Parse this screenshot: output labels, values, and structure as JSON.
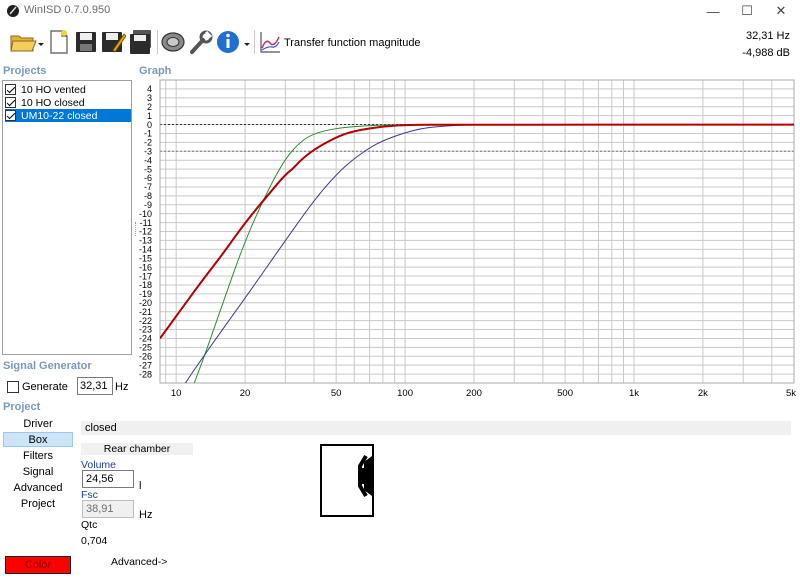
{
  "window": {
    "title": "WinISD 0.7.0.950",
    "minimize_glyph": "—",
    "maximize_glyph": "☐",
    "close_glyph": "✕"
  },
  "toolbar": {
    "icons": [
      "folder-open-icon",
      "new-document-icon",
      "save-icon",
      "save-as-icon",
      "save-all-icon",
      "driver-icon",
      "wrench-icon",
      "info-icon",
      "graph-icon"
    ],
    "graph_type_label": "Transfer function magnitude",
    "readout_freq": "32,31 Hz",
    "readout_level": "-4,988 dB"
  },
  "projects": {
    "label": "Projects",
    "items": [
      {
        "label": "10 HO vented",
        "checked": true,
        "selected": false
      },
      {
        "label": "10 HO closed",
        "checked": true,
        "selected": false
      },
      {
        "label": "UM10-22 closed",
        "checked": true,
        "selected": true
      }
    ]
  },
  "graph": {
    "label": "Graph"
  },
  "chart_data": {
    "type": "line",
    "title": "",
    "xlabel": "",
    "ylabel": "",
    "x_scale": "log",
    "xlim": [
      8.5,
      5000
    ],
    "ylim": [
      -29,
      5
    ],
    "x_tick_labels": [
      "10",
      "20",
      "50",
      "100",
      "200",
      "500",
      "1k",
      "2k",
      "5k"
    ],
    "x_tick_values": [
      10,
      20,
      50,
      100,
      200,
      500,
      1000,
      2000,
      5000
    ],
    "y_tick_values": [
      4,
      3,
      2,
      1,
      0,
      -1,
      -2,
      -3,
      -4,
      -5,
      -6,
      -7,
      -8,
      -9,
      -10,
      -11,
      -12,
      -13,
      -14,
      -15,
      -16,
      -17,
      -18,
      -19,
      -20,
      -21,
      -22,
      -23,
      -24,
      -25,
      -26,
      -27,
      -28
    ],
    "reference_lines": [
      0,
      -3
    ],
    "grid": true,
    "series": [
      {
        "color": "#2e8b2e",
        "width": 1,
        "points": [
          [
            12,
            -29
          ],
          [
            13.5,
            -25.5
          ],
          [
            16,
            -20
          ],
          [
            20,
            -13
          ],
          [
            25,
            -7.5
          ],
          [
            30,
            -3.8
          ],
          [
            35,
            -1.9
          ],
          [
            40,
            -1
          ],
          [
            50,
            -0.4
          ],
          [
            70,
            -0.1
          ],
          [
            100,
            0
          ],
          [
            200,
            0
          ]
        ]
      },
      {
        "color": "#3a3a8a",
        "width": 1,
        "points": [
          [
            9,
            -33
          ],
          [
            10,
            -30.5
          ],
          [
            14,
            -25
          ],
          [
            20,
            -19.5
          ],
          [
            30,
            -13
          ],
          [
            40,
            -8.5
          ],
          [
            50,
            -5.6
          ],
          [
            60,
            -3.8
          ],
          [
            70,
            -2.6
          ],
          [
            80,
            -1.8
          ],
          [
            100,
            -0.9
          ],
          [
            120,
            -0.4
          ],
          [
            150,
            -0.15
          ],
          [
            200,
            0
          ]
        ]
      },
      {
        "color": "#b00000",
        "width": 2,
        "points": [
          [
            8.5,
            -24
          ],
          [
            10,
            -21.5
          ],
          [
            13,
            -17.5
          ],
          [
            16,
            -14.5
          ],
          [
            20,
            -11
          ],
          [
            25,
            -8
          ],
          [
            30,
            -5.6
          ],
          [
            32.31,
            -4.988
          ],
          [
            35,
            -4
          ],
          [
            40,
            -2.8
          ],
          [
            50,
            -1.4
          ],
          [
            60,
            -0.7
          ],
          [
            80,
            -0.2
          ],
          [
            100,
            -0.05
          ],
          [
            150,
            0
          ],
          [
            5000,
            0
          ]
        ]
      }
    ]
  },
  "signal_generator": {
    "label": "Signal Generator",
    "generate_label": "Generate",
    "frequency_value": "32,31",
    "unit": "Hz"
  },
  "project_section": {
    "label": "Project",
    "nav": [
      "Driver",
      "Box",
      "Filters",
      "Signal",
      "Advanced",
      "Project"
    ],
    "active_nav": "Box",
    "color_button_label": "Color",
    "color_button_color": "#ff0000"
  },
  "box_panel": {
    "project_name": "closed",
    "rear_chamber_label": "Rear chamber",
    "volume_label": "Volume",
    "volume_value": "24,56",
    "volume_unit": "l",
    "fsc_label": "Fsc",
    "fsc_value": "38,91",
    "fsc_unit": "Hz",
    "qtc_label": "Qtc",
    "qtc_value": "0,704",
    "advanced_label": "Advanced->"
  }
}
